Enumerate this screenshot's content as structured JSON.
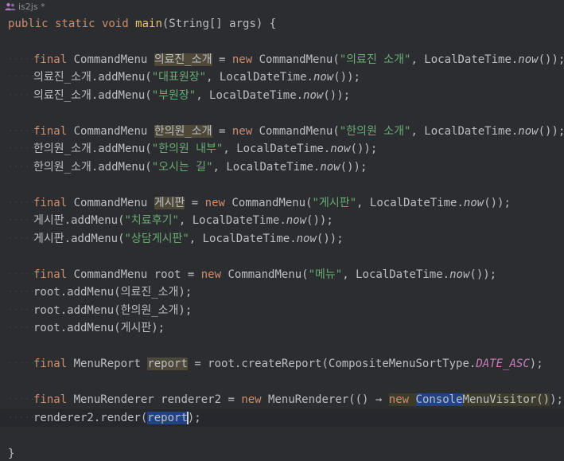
{
  "tab": {
    "title": "is2js *"
  },
  "lines": {
    "l0": "public static void main(String[] args) {",
    "l1": "",
    "l2a": "final",
    "l2b": " CommandMenu ",
    "l2c": "의료진_소개",
    "l2d": " = ",
    "l2e": "new",
    "l2f": " CommandMenu(",
    "l2g": "\"의료진 소개\"",
    "l2h": ", LocalDateTime.",
    "l2i": "now",
    "l2j": "());",
    "l3a": "의료진_소개.addMenu(",
    "l3b": "\"대표원장\"",
    "l3c": ", LocalDateTime.",
    "l3d": "now",
    "l3e": "());",
    "l4a": "의료진_소개.addMenu(",
    "l4b": "\"부원장\"",
    "l4c": ", LocalDateTime.",
    "l4d": "now",
    "l4e": "());",
    "l6a": "final",
    "l6b": " CommandMenu ",
    "l6c": "한의원_소개",
    "l6d": " = ",
    "l6e": "new",
    "l6f": " CommandMenu(",
    "l6g": "\"한의원 소개\"",
    "l6h": ", LocalDateTime.",
    "l6i": "now",
    "l6j": "());",
    "l7a": "한의원_소개.addMenu(",
    "l7b": "\"한의원 내부\"",
    "l7c": ", LocalDateTime.",
    "l7d": "now",
    "l7e": "());",
    "l8a": "한의원_소개.addMenu(",
    "l8b": "\"오시는 길\"",
    "l8c": ", LocalDateTime.",
    "l8d": "now",
    "l8e": "());",
    "l10a": "final",
    "l10b": " CommandMenu ",
    "l10c": "게시판",
    "l10d": " = ",
    "l10e": "new",
    "l10f": " CommandMenu(",
    "l10g": "\"게시판\"",
    "l10h": ", LocalDateTime.",
    "l10i": "now",
    "l10j": "());",
    "l11a": "게시판.addMenu(",
    "l11b": "\"치료후기\"",
    "l11c": ", LocalDateTime.",
    "l11d": "now",
    "l11e": "());",
    "l12a": "게시판.addMenu(",
    "l12b": "\"상담게시판\"",
    "l12c": ", LocalDateTime.",
    "l12d": "now",
    "l12e": "());",
    "l14a": "final",
    "l14b": " CommandMenu root = ",
    "l14c": "new",
    "l14d": " CommandMenu(",
    "l14e": "\"메뉴\"",
    "l14f": ", LocalDateTime.",
    "l14g": "now",
    "l14h": "());",
    "l15": "root.addMenu(의료진_소개);",
    "l16": "root.addMenu(한의원_소개);",
    "l17": "root.addMenu(게시판);",
    "l19a": "final",
    "l19b": " MenuReport ",
    "l19c": "report",
    "l19d": " = root.createReport(CompositeMenuSortType.",
    "l19e": "DATE_ASC",
    "l19f": ");",
    "l21a": "final",
    "l21b": " MenuRenderer renderer2 = ",
    "l21c": "new",
    "l21d": " MenuRenderer(() ",
    "l21e": "→",
    "l21f": " ",
    "l21g": "new",
    "l21h": " ",
    "l21i": "Console",
    "l21j": "MenuVisitor()",
    "l21k": ");",
    "l22a": "renderer2.render(",
    "l22b": "report",
    "l22c": ");",
    "l24": "}"
  }
}
